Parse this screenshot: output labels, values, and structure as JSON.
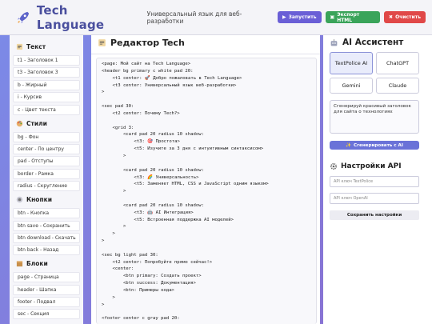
{
  "header": {
    "title": "Tech Language",
    "subtitle": "Универсальный язык для веб-разработки",
    "run_label": "Запустить",
    "export_label": "Экспорт HTML",
    "clear_label": "Очистить"
  },
  "sidebar": {
    "sections": [
      {
        "title": "Текст",
        "icon": "memo-icon",
        "items": [
          "t1 - Заголовок 1",
          "t3 - Заголовок 3",
          "b - Жирный",
          "i - Курсив",
          "c - Цвет текста"
        ]
      },
      {
        "title": "Стили",
        "icon": "palette-icon",
        "items": [
          "bg - Фон",
          "center - По центру",
          "pad - Отступы",
          "border - Рамка",
          "radius - Скругление"
        ]
      },
      {
        "title": "Кнопки",
        "icon": "button-icon",
        "items": [
          "btn - Кнопка",
          "btn save - Сохранить",
          "btn download - Скачать",
          "btn back - Назад"
        ]
      },
      {
        "title": "Блоки",
        "icon": "box-icon",
        "items": [
          "page - Страница",
          "header - Шапка",
          "footer - Подвал",
          "sec - Секция"
        ]
      }
    ]
  },
  "editor": {
    "title": "Редактор Tech",
    "lines": [
      "<page: Мой сайт на Tech Language>",
      "<header bg primary c white pad 20:",
      "    <t1 center: 🚀 Добро пожаловать в Tech Language>",
      "    <t3 center: Универсальный язык веб-разработки>",
      ">",
      "",
      "<sec pad 30:",
      "    <t2 center: Почему Tech?>",
      "",
      "    <grid 3:",
      "        <card pad 20 radius 10 shadow:",
      "            <t3: 🎯 Простота>",
      "            <t5: Изучите за 3 дня с интуитивным синтаксисом>",
      "        >",
      "",
      "        <card pad 20 radius 10 shadow:",
      "            <t3: 🌈 Универсальность>",
      "            <t5: Заменяет HTML, CSS и JavaScript одним языком>",
      "        >",
      "",
      "        <card pad 20 radius 10 shadow:",
      "            <t3: 🤖 AI Интеграция>",
      "            <t5: Встроенная поддержка AI моделей>",
      "        >",
      "    >",
      ">",
      "",
      "<sec bg light pad 30:",
      "    <t2 center: Попробуйте прямо сейчас!>",
      "    <center:",
      "        <btn primary: Создать проект>",
      "        <btn success: Документация>",
      "        <btn: Примеры кода>",
      "    >",
      ">",
      "",
      "<footer center c gray pad 20:"
    ]
  },
  "ai": {
    "title": "AI Ассистент",
    "models": [
      "TextPolice AI",
      "ChatGPT",
      "Gemini",
      "Claude"
    ],
    "prompt": "Сгенерируй красивый заголовок для сайта о технологиях",
    "generate_label": "Сгенерировать с AI"
  },
  "api": {
    "title": "Настройки API",
    "textpolice_placeholder": "API ключ TextPolice",
    "openai_placeholder": "API ключ OpenAI",
    "save_label": "Сохранить настройки"
  },
  "colors": {
    "accent": "#6a5fd6",
    "export": "#3aa45a",
    "clear": "#e04848",
    "title": "#4a4f9e",
    "background": "#7b8be8"
  }
}
